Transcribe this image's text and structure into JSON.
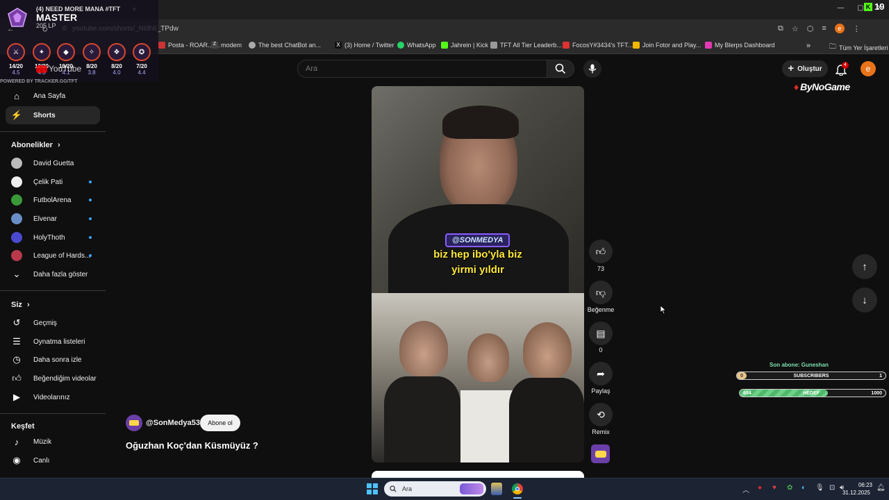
{
  "browser": {
    "tab_title": "YouTube",
    "url": "youtube.com/shorts/_N6lh6_TPdw",
    "profile_letter": "e",
    "counter": "19",
    "bookmarks": [
      {
        "label": "Posta - ROAR... ...",
        "color": "#c33"
      },
      {
        "label": "modem",
        "color": "#444"
      },
      {
        "label": "The best ChatBot an...",
        "color": "#aaa"
      },
      {
        "label": "(3) Home / Twitter",
        "color": "#111"
      },
      {
        "label": "WhatsApp",
        "color": "#25d366"
      },
      {
        "label": "Jahrein | Kick",
        "color": "#53fc18"
      },
      {
        "label": "TFT All Tier Leaderb...",
        "color": "#999"
      },
      {
        "label": "FocosY#3434's TFT...",
        "color": "#d33"
      },
      {
        "label": "Join Fotor and Play...",
        "color": "#f2b600"
      },
      {
        "label": "My Blerps Dashboard",
        "color": "#e23ab4"
      }
    ],
    "all_bookmarks": "Tüm Yer İşaretleri",
    "more_bookmarks": "»"
  },
  "overlay": {
    "tab_label": "(4) NEED MORE MANA #TFT",
    "rank": "MASTER",
    "lp": "205 LP",
    "stats": [
      {
        "top": "14/20",
        "sub": "4.5"
      },
      {
        "top": "12/20",
        "sub": "4.3"
      },
      {
        "top": "10/20",
        "sub": "4.1"
      },
      {
        "top": "8/20",
        "sub": "3.8"
      },
      {
        "top": "8/20",
        "sub": "4.0"
      },
      {
        "top": "7/20",
        "sub": "4.4"
      }
    ],
    "powered": "POWERED BY TRACKER.GG/TFT"
  },
  "sidebar": {
    "logo": "YouTube",
    "main": [
      {
        "label": "Ana Sayfa",
        "icon": "home-icon"
      },
      {
        "label": "Shorts",
        "icon": "shorts-icon"
      }
    ],
    "subs_header": "Abonelikler",
    "subs": [
      {
        "label": "David Guetta",
        "color": "#bbb",
        "dot": false
      },
      {
        "label": "Çelik Pati",
        "color": "#eee",
        "dot": true
      },
      {
        "label": "FutbolArena",
        "color": "#3a9a3a",
        "dot": true
      },
      {
        "label": "Elvenar",
        "color": "#6a8fc8",
        "dot": true
      },
      {
        "label": "HolyThoth",
        "color": "#4a4ad0",
        "dot": true
      },
      {
        "label": "League of Hards...",
        "color": "#b83a4a",
        "dot": true
      }
    ],
    "show_more": "Daha fazla göster",
    "you_header": "Siz",
    "you": [
      {
        "label": "Geçmiş",
        "icon": "history-icon"
      },
      {
        "label": "Oynatma listeleri",
        "icon": "playlists-icon"
      },
      {
        "label": "Daha sonra izle",
        "icon": "watch-later-icon"
      },
      {
        "label": "Beğendiğim videolar",
        "icon": "liked-icon"
      },
      {
        "label": "Videolarınız",
        "icon": "your-videos-icon"
      }
    ],
    "explore_header": "Keşfet",
    "explore": [
      {
        "label": "Müzik",
        "icon": "music-icon"
      },
      {
        "label": "Canlı",
        "icon": "live-icon"
      }
    ]
  },
  "header": {
    "search_placeholder": "Ara",
    "create_label": "Oluştur",
    "notif_count": "4",
    "avatar_letter": "e",
    "brand": "ByNoGame"
  },
  "short": {
    "tag": "@SONMEDYA",
    "caption_line1": "biz hep ibo'yla biz",
    "caption_line2": "yirmi yıldır",
    "channel": "@SonMedya53",
    "subscribe": "Abone ol",
    "title": "Oğuzhan Koç'dan Küsmüyüz ?",
    "likes": "73",
    "dislike_label": "Beğenme",
    "comments": "0",
    "share_label": "Paylaş",
    "remix_label": "Remix"
  },
  "widget": {
    "last_sub": "Son abone: Guneshan",
    "bar1_left": "0",
    "bar1_mid": "SUBSCRIBERS",
    "bar1_right": "1",
    "bar1_fill": 0.0,
    "bar2_left": "604",
    "bar2_mid": "HEDEF",
    "bar2_right": "1000",
    "bar2_fill": 0.604
  },
  "taskbar": {
    "search": "Ara",
    "time": "06:23",
    "date": "31.12.2025"
  }
}
